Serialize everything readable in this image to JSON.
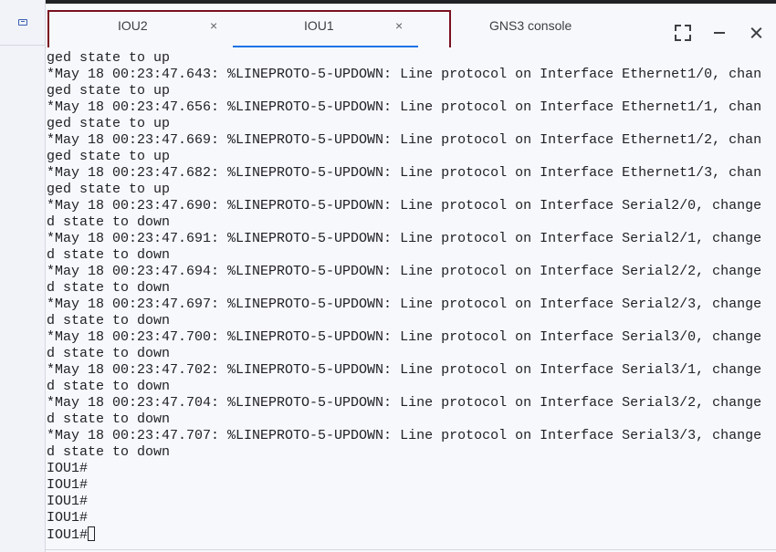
{
  "tabs": [
    {
      "label": "IOU2",
      "close": "×",
      "active": false
    },
    {
      "label": "IOU1",
      "close": "×",
      "active": true
    },
    {
      "label": "GNS3 console",
      "active": false
    }
  ],
  "terminal": {
    "lines": [
      "ged state to up",
      "*May 18 00:23:47.643: %LINEPROTO-5-UPDOWN: Line protocol on Interface Ethernet1/0, chan",
      "ged state to up",
      "*May 18 00:23:47.656: %LINEPROTO-5-UPDOWN: Line protocol on Interface Ethernet1/1, chan",
      "ged state to up",
      "*May 18 00:23:47.669: %LINEPROTO-5-UPDOWN: Line protocol on Interface Ethernet1/2, chan",
      "ged state to up",
      "*May 18 00:23:47.682: %LINEPROTO-5-UPDOWN: Line protocol on Interface Ethernet1/3, chan",
      "ged state to up",
      "*May 18 00:23:47.690: %LINEPROTO-5-UPDOWN: Line protocol on Interface Serial2/0, change",
      "d state to down",
      "*May 18 00:23:47.691: %LINEPROTO-5-UPDOWN: Line protocol on Interface Serial2/1, change",
      "d state to down",
      "*May 18 00:23:47.694: %LINEPROTO-5-UPDOWN: Line protocol on Interface Serial2/2, change",
      "d state to down",
      "*May 18 00:23:47.697: %LINEPROTO-5-UPDOWN: Line protocol on Interface Serial2/3, change",
      "d state to down",
      "*May 18 00:23:47.700: %LINEPROTO-5-UPDOWN: Line protocol on Interface Serial3/0, change",
      "d state to down",
      "*May 18 00:23:47.702: %LINEPROTO-5-UPDOWN: Line protocol on Interface Serial3/1, change",
      "d state to down",
      "*May 18 00:23:47.704: %LINEPROTO-5-UPDOWN: Line protocol on Interface Serial3/2, change",
      "d state to down",
      "*May 18 00:23:47.707: %LINEPROTO-5-UPDOWN: Line protocol on Interface Serial3/3, change",
      "d state to down",
      "IOU1#",
      "IOU1#",
      "IOU1#",
      "IOU1#"
    ],
    "prompt": "IOU1#"
  },
  "colors": {
    "accent": "#1a73e8",
    "highlight": "#7a1020",
    "background": "#f7f8fc"
  },
  "icons": {
    "sidebar": "terminal-icon",
    "fullscreen": "fullscreen-icon",
    "minimize": "minimize-icon",
    "close": "close-icon"
  }
}
